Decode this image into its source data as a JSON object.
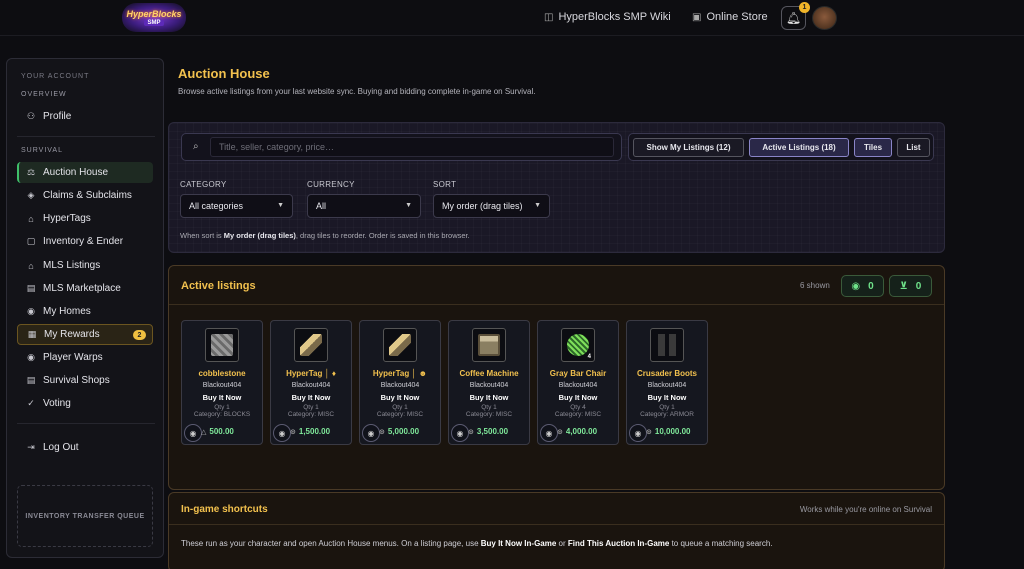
{
  "brand": {
    "line1": "HyperBlocks",
    "line2": "SMP"
  },
  "topnav": {
    "wiki_label": "HyperBlocks SMP Wiki",
    "store_label": "Online Store",
    "notification_count": "1"
  },
  "sidebar": {
    "section_account": "YOUR ACCOUNT",
    "sub_overview": "OVERVIEW",
    "profile": "Profile",
    "section_survival": "SURVIVAL",
    "items": [
      {
        "label": "Auction House"
      },
      {
        "label": "Claims & Subclaims"
      },
      {
        "label": "HyperTags"
      },
      {
        "label": "Inventory & Ender"
      },
      {
        "label": "MLS Listings"
      },
      {
        "label": "MLS Marketplace"
      },
      {
        "label": "My Homes"
      },
      {
        "label": "My Rewards",
        "badge": "2"
      },
      {
        "label": "Player Warps"
      },
      {
        "label": "Survival Shops"
      },
      {
        "label": "Voting"
      }
    ],
    "logout": "Log Out",
    "transfer_queue": "INVENTORY TRANSFER QUEUE"
  },
  "page": {
    "title": "Auction House",
    "subtitle": "Browse active listings from your last website sync. Buying and bidding complete in-game on Survival."
  },
  "filters": {
    "search_placeholder": "Title, seller, category, price…",
    "buttons": {
      "my_listings": "Show My Listings (12)",
      "active": "Active Listings (18)",
      "tiles": "Tiles",
      "list": "List"
    },
    "category_label": "CATEGORY",
    "category_value": "All categories",
    "currency_label": "CURRENCY",
    "currency_value": "All",
    "sort_label": "SORT",
    "sort_value": "My order (drag tiles)",
    "note_prefix": "When sort is ",
    "note_bold": "My order (drag tiles)",
    "note_suffix": ", drag tiles to reorder. Order is saved in this browser."
  },
  "listings": {
    "title": "Active listings",
    "shown": "6 shown",
    "watch_count": "0",
    "cart_count": "0",
    "items": [
      {
        "name": "cobblestone",
        "seller": "Blackout404",
        "mode": "Buy It Now",
        "qty": "Qty 1",
        "category": "Category: BLOCKS",
        "price": "500.00",
        "currency_icon": "△",
        "art": "#8a8a8a"
      },
      {
        "name": "HyperTag │ ♦",
        "seller": "Blackout404",
        "mode": "Buy It Now",
        "qty": "Qty 1",
        "category": "Category: MISC",
        "price": "1,500.00",
        "currency_icon": "⊙",
        "art": "#c9a86a"
      },
      {
        "name": "HyperTag │ ☻",
        "seller": "Blackout404",
        "mode": "Buy It Now",
        "qty": "Qty 1",
        "category": "Category: MISC",
        "price": "5,000.00",
        "currency_icon": "⊙",
        "art": "#c9a86a"
      },
      {
        "name": "Coffee Machine",
        "seller": "Blackout404",
        "mode": "Buy It Now",
        "qty": "Qty 1",
        "category": "Category: MISC",
        "price": "3,500.00",
        "currency_icon": "⊙",
        "art": "#b8ad8f"
      },
      {
        "name": "Gray Bar Chair",
        "seller": "Blackout404",
        "mode": "Buy It Now",
        "qty": "Qty 4",
        "category": "Category: MISC",
        "price": "4,000.00",
        "currency_icon": "⊙",
        "art": "#6ccf4a",
        "stack": "4"
      },
      {
        "name": "Crusader Boots",
        "seller": "Blackout404",
        "mode": "Buy It Now",
        "qty": "Qty 1",
        "category": "Category: ARMOR",
        "price": "10,000.00",
        "currency_icon": "⊙",
        "art": "#4a4a4a"
      }
    ]
  },
  "shortcuts": {
    "title": "In-game shortcuts",
    "hint": "Works while you're online on Survival",
    "body_a": "These run as your character and open Auction House menus. On a listing page, use ",
    "body_b": "Buy It Now In-Game",
    "body_c": " or ",
    "body_d": "Find This Auction In-Game",
    "body_e": " to queue a matching search."
  }
}
